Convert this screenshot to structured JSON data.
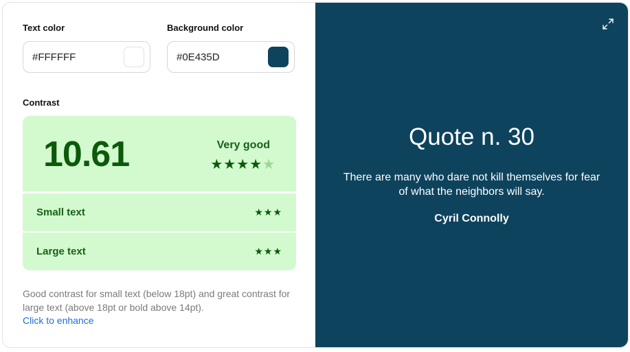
{
  "text_color": {
    "label": "Text color",
    "value": "#FFFFFF",
    "swatch": "#FFFFFF"
  },
  "background_color": {
    "label": "Background color",
    "value": "#0E435D",
    "swatch": "#0E435D"
  },
  "contrast": {
    "label": "Contrast",
    "ratio": "10.61",
    "rating": "Very good",
    "stars_filled": 4,
    "stars_total": 5,
    "rows": [
      {
        "label": "Small text",
        "stars": "★★★"
      },
      {
        "label": "Large text",
        "stars": "★★★"
      }
    ],
    "box_color": "#D3F9CE",
    "accent_color": "#0B5A0B"
  },
  "description": "Good contrast for small text (below 18pt) and great contrast for large text (above 18pt or bold above 14pt).",
  "enhance_link": "Click to enhance",
  "preview": {
    "expand_icon": "expand-icon",
    "title": "Quote n. 30",
    "text": "There are many who dare not kill themselves for fear of what the neighbors will say.",
    "author": "Cyril Connolly"
  }
}
